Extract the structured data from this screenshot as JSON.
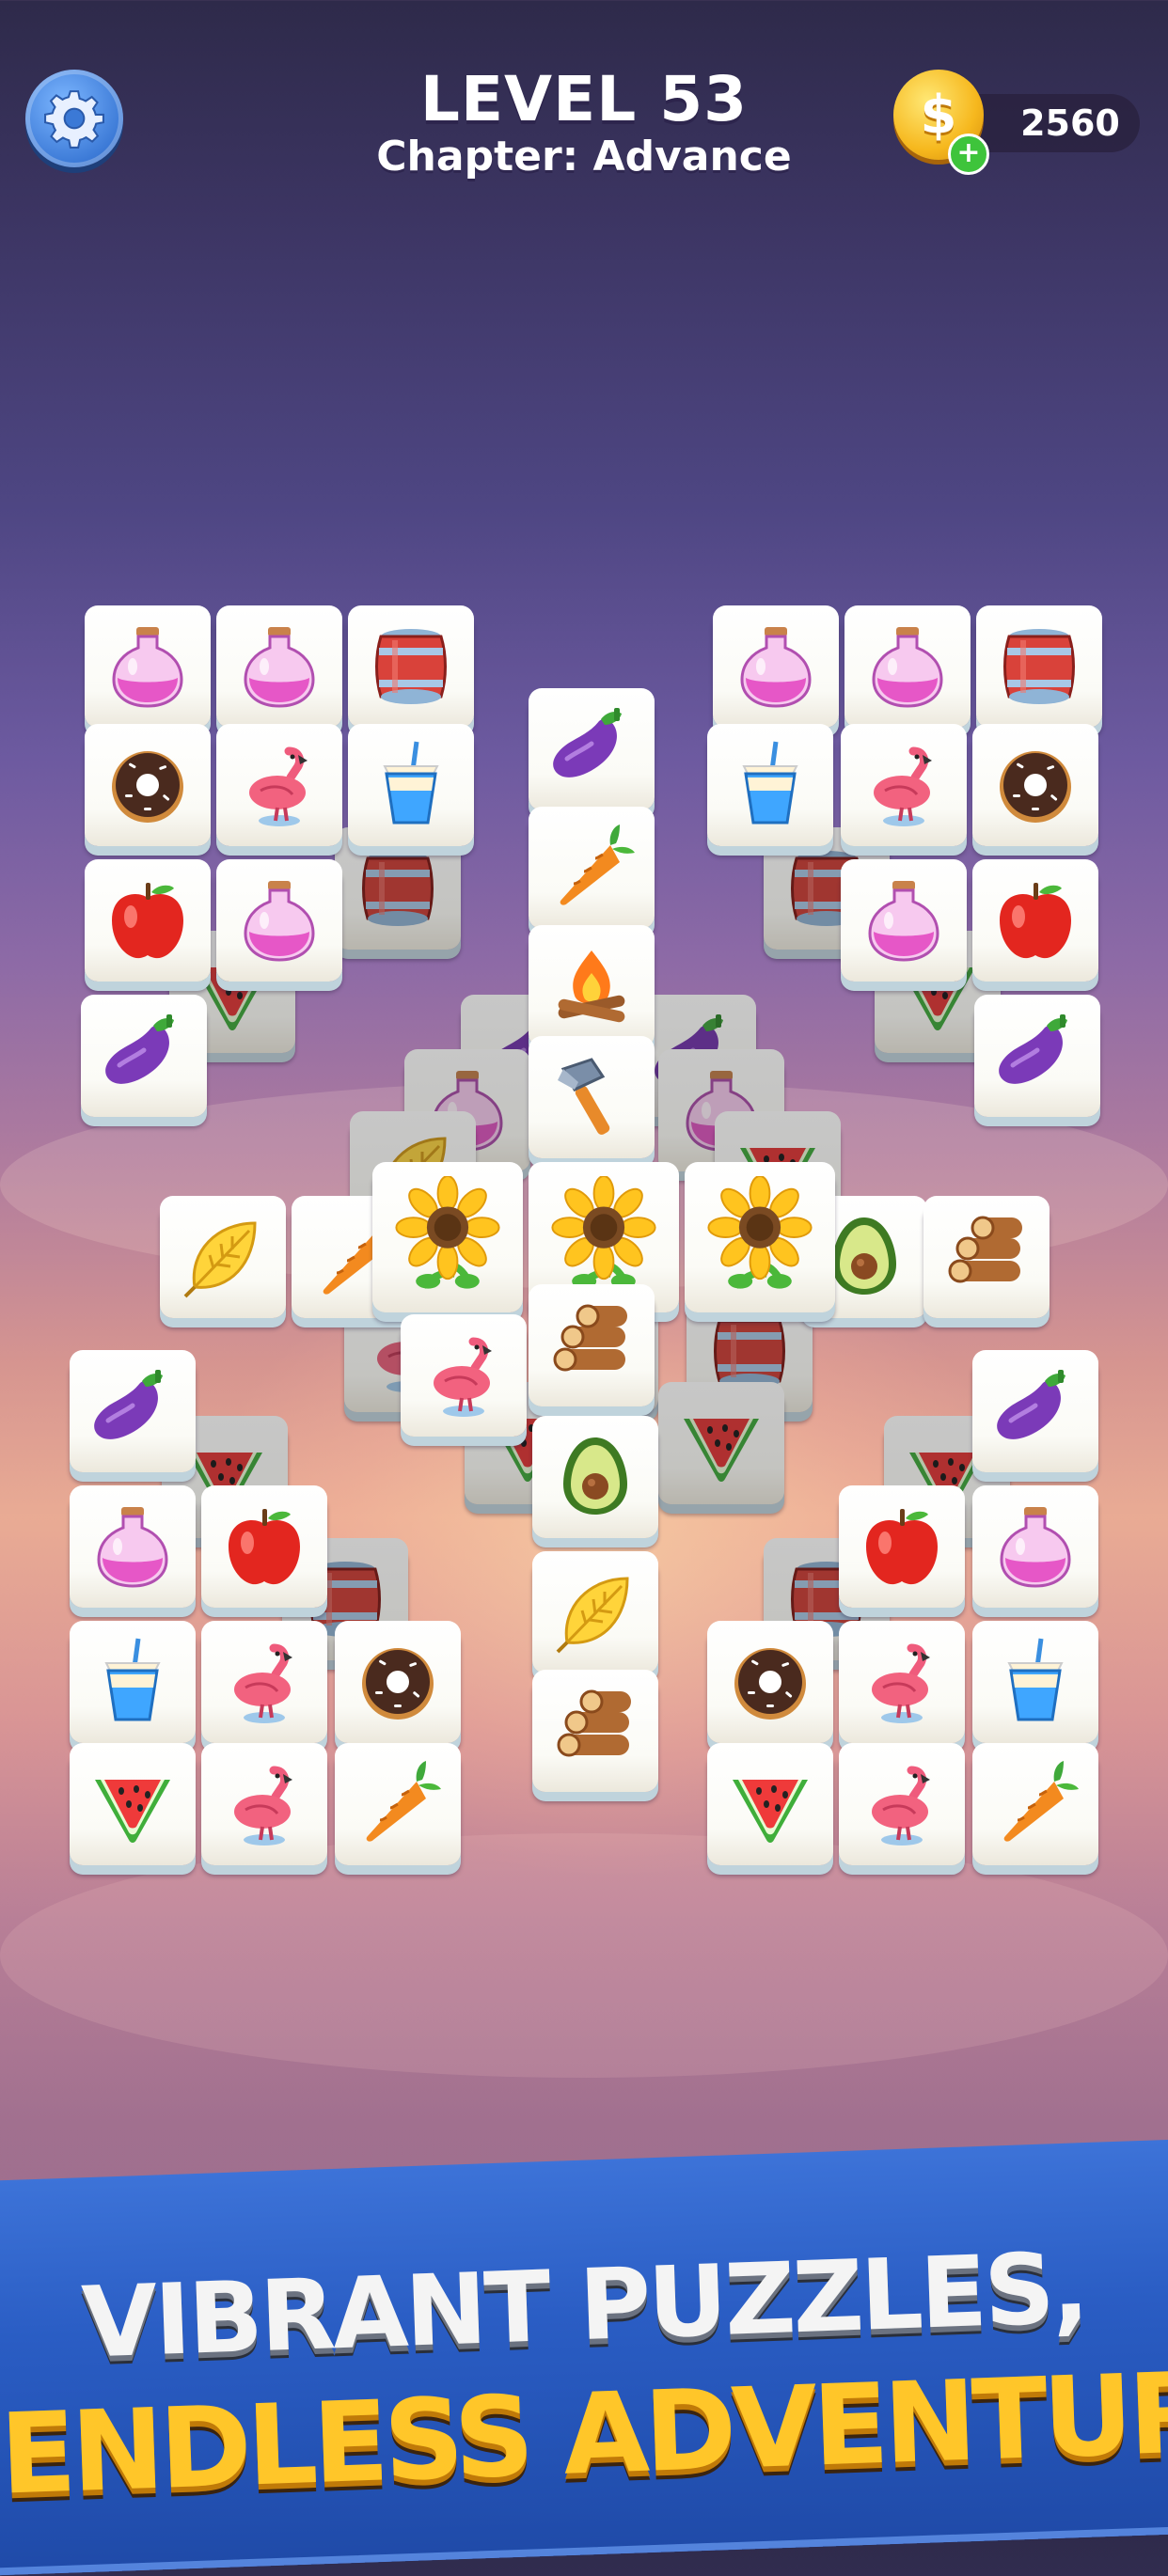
{
  "header": {
    "level": "LEVEL 53",
    "chapter": "Chapter: Advance",
    "coins": "2560",
    "coin_symbol": "$",
    "coin_add": "+"
  },
  "icons": {
    "settings": "gear-icon",
    "coin": "coin-icon",
    "add": "plus-icon"
  },
  "tile_types": [
    "potion",
    "barrel",
    "donut",
    "flamingo",
    "drink",
    "apple",
    "eggplant",
    "carrot",
    "campfire",
    "hammer",
    "watermelon",
    "leaf",
    "sunflower",
    "avocado",
    "logs"
  ],
  "banner": {
    "line1": "VIBRANT PUZZLES,",
    "line2": "ENDLESS ADVENTURE."
  },
  "colors": {
    "banner_blue": "#2a5dc4",
    "banner_yellow": "#ffc629",
    "coin_gold": "#f6b81e",
    "settings_blue": "#3b79d6"
  }
}
